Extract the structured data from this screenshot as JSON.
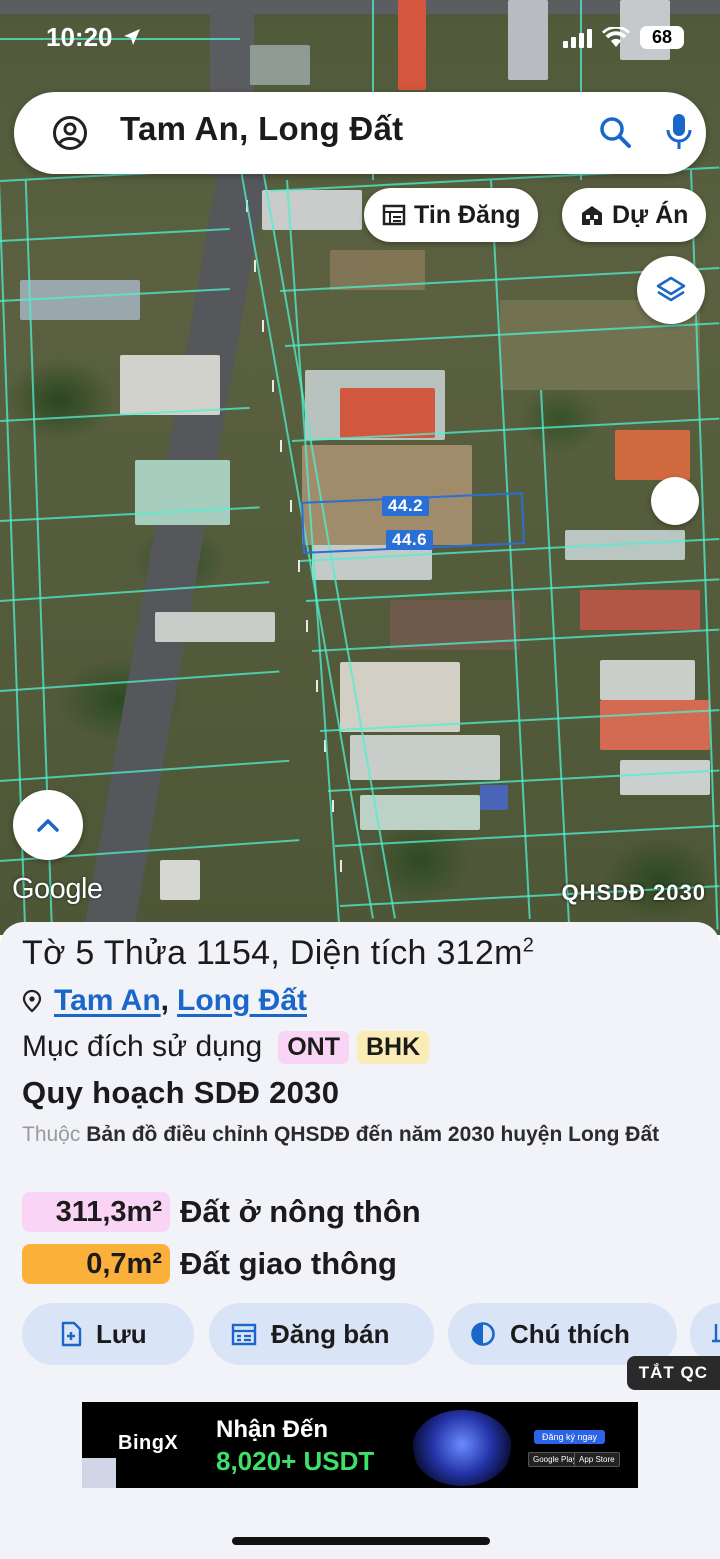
{
  "status_bar": {
    "time": "10:20",
    "battery": "68"
  },
  "search": {
    "query": "Tam An, Long Đất"
  },
  "map_chips": {
    "listings": "Tin Đăng",
    "projects": "Dự Án"
  },
  "parcel_dimensions": {
    "top": "44.2",
    "bottom": "44.6"
  },
  "map": {
    "logo": "Google",
    "layer_badge": "QHSDĐ 2030"
  },
  "parcel": {
    "title": "Tờ 5 Thửa 1154, Diện tích 312m",
    "title_sup": "2",
    "location_ward": "Tam An",
    "location_separator": ",",
    "location_district": "Long Đất",
    "purpose_label": "Mục đích sử dụng",
    "tags": [
      {
        "code": "ONT",
        "bg": "#f9d4f4"
      },
      {
        "code": "BHK",
        "bg": "#fbecb7"
      }
    ],
    "plan_title": "Quy hoạch SDĐ 2030",
    "plan_prefix": "Thuộc",
    "plan_desc": "Bản đồ điều chỉnh QHSDĐ đến năm 2030 huyện Long Đất",
    "areas": [
      {
        "value": "311,3m²",
        "label": "Đất ở nông thôn",
        "bg": "#f9d4f4"
      },
      {
        "value": "0,7m²",
        "label": "Đất giao thông",
        "bg": "#fbb03b"
      }
    ]
  },
  "actions": {
    "save": "Lưu",
    "post_sale": "Đăng bán",
    "legend": "Chú thích"
  },
  "ad": {
    "off_label": "TẮT QC",
    "brand": "BingX",
    "headline": "Nhận Đến",
    "amount": "8,020+ USDT",
    "cta": "Đăng ký ngay",
    "store_google": "Google Play",
    "store_apple": "App Store"
  },
  "colors": {
    "accent": "#1a66c9",
    "sheet_bg": "#f1f3f8",
    "button_bg": "#d9e4f6",
    "parcel_line": "#4ff0d0"
  }
}
